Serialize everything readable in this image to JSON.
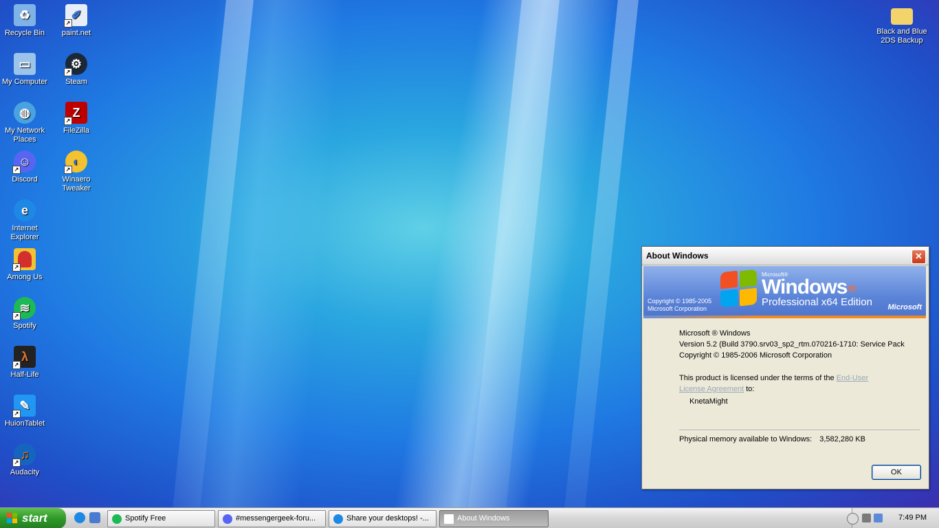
{
  "desktop": {
    "icons_left": [
      {
        "label": "Recycle Bin",
        "icon": "recycle-bin-icon",
        "color": "#7fb3e8"
      },
      {
        "label": "My Computer",
        "icon": "computer-icon",
        "color": "#9cc3ea"
      },
      {
        "label": "My Network Places",
        "icon": "network-icon",
        "color": "#4aa3e0"
      },
      {
        "label": "Discord",
        "icon": "discord-icon",
        "color": "#5865f2"
      },
      {
        "label": "Internet Explorer",
        "icon": "internet-explorer-icon",
        "color": "#1e88e5"
      },
      {
        "label": "Among Us",
        "icon": "among-us-icon",
        "color": "#d32f2f"
      },
      {
        "label": "Spotify",
        "icon": "spotify-icon",
        "color": "#1db954"
      },
      {
        "label": "Half-Life",
        "icon": "half-life-icon",
        "color": "#e8772e"
      },
      {
        "label": "HuionTablet",
        "icon": "huion-tablet-icon",
        "color": "#2196f3"
      },
      {
        "label": "Audacity",
        "icon": "audacity-icon",
        "color": "#f57c00"
      }
    ],
    "icons_col2": [
      {
        "label": "paint.net",
        "icon": "paint-net-icon",
        "color": "#3f7ad6"
      },
      {
        "label": "Steam",
        "icon": "steam-icon",
        "color": "#1b2838"
      },
      {
        "label": "FileZilla",
        "icon": "filezilla-icon",
        "color": "#bf0000"
      },
      {
        "label": "Winaero Tweaker",
        "icon": "winaero-tweaker-icon",
        "color": "#f2c230"
      }
    ],
    "icons_right": [
      {
        "label": "Black and Blue 2DS Backup",
        "icon": "folder-icon",
        "color": "#f3d36b"
      }
    ]
  },
  "dialog": {
    "title": "About Windows",
    "close_label": "✕",
    "banner": {
      "microsoft_small": "Microsoft®",
      "windows": "Windows",
      "xp": "xp",
      "edition": "Professional x64 Edition",
      "copyright_line1": "Copyright © 1985-2005",
      "copyright_line2": "Microsoft Corporation",
      "microsoft_logo": "Microsoft"
    },
    "lines": {
      "product": "Microsoft ® Windows",
      "version": "Version 5.2 (Build 3790.srv03_sp2_rtm.070216-1710: Service Pack",
      "copyright": "Copyright © 1985-2006 Microsoft Corporation",
      "license_pre": "This product is licensed under the terms of the ",
      "license_link": "End-User License Agreement",
      "license_post": " to:",
      "user": "KnetaMight",
      "memory_label": "Physical memory available to Windows:",
      "memory_value": "3,582,280 KB"
    },
    "ok_label": "OK"
  },
  "taskbar": {
    "start_label": "start",
    "buttons": [
      {
        "label": "Spotify Free",
        "icon": "spotify-icon",
        "color": "#1db954"
      },
      {
        "label": "#messengergeek-foru...",
        "icon": "discord-icon",
        "color": "#5865f2"
      },
      {
        "label": "Share your desktops! -...",
        "icon": "internet-explorer-icon",
        "color": "#1e88e5"
      },
      {
        "label": "About Windows",
        "icon": "window-icon",
        "color": "#ffffff"
      }
    ],
    "clock": "7:49 PM"
  }
}
